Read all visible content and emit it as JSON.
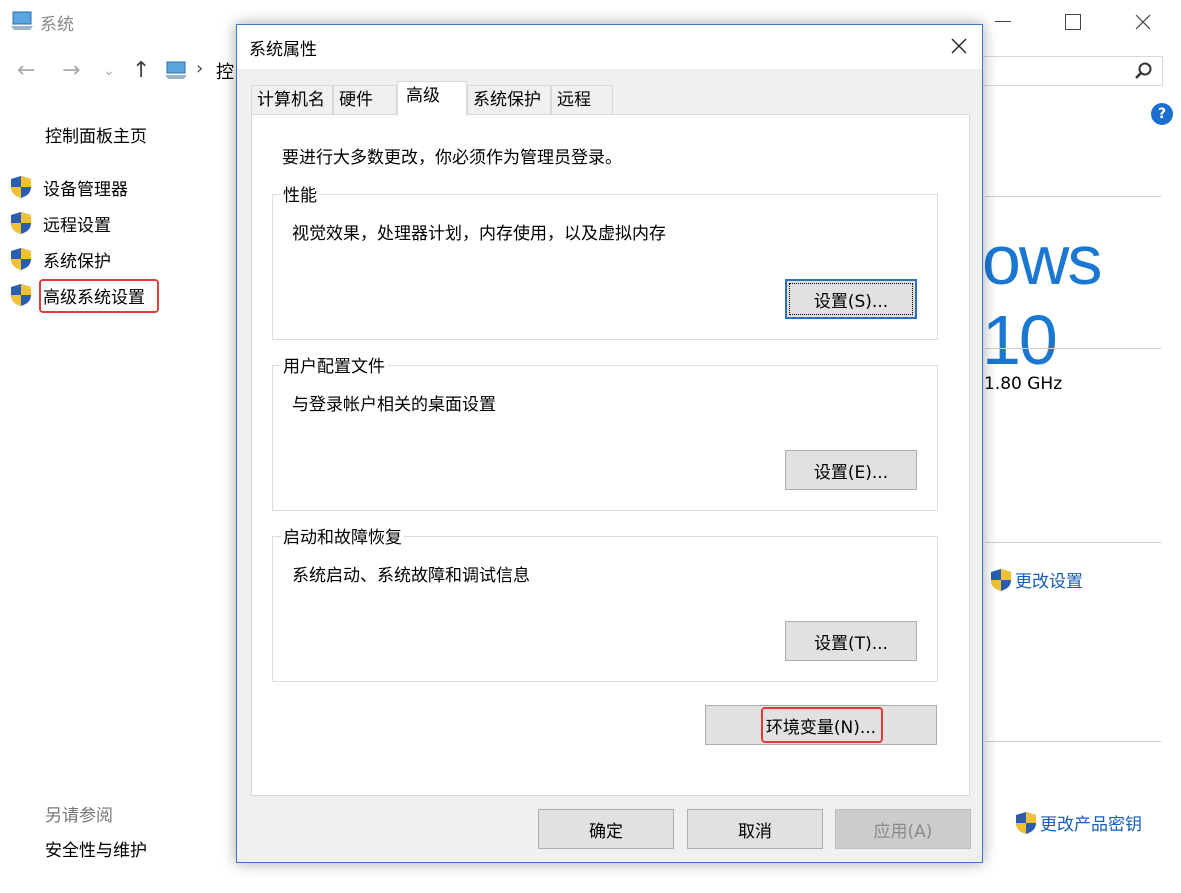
{
  "background_window": {
    "title": "系统",
    "breadcrumb_partial": "控",
    "sidebar": {
      "home": "控制面板主页",
      "items": [
        {
          "label": "设备管理器"
        },
        {
          "label": "远程设置"
        },
        {
          "label": "系统保护"
        },
        {
          "label": "高级系统设置"
        }
      ],
      "see_also": "另请参阅",
      "security": "安全性与维护"
    },
    "brand_partial": "ows 10",
    "cpu_speed_partial": "1.80 GHz",
    "change_settings": "更改设置",
    "change_product_key": "更改产品密钥"
  },
  "dialog": {
    "title": "系统属性",
    "tabs": [
      {
        "label": "计算机名"
      },
      {
        "label": "硬件"
      },
      {
        "label": "高级"
      },
      {
        "label": "系统保护"
      },
      {
        "label": "远程"
      }
    ],
    "active_tab": "高级",
    "notice": "要进行大多数更改，你必须作为管理员登录。",
    "groups": [
      {
        "title": "性能",
        "desc": "视觉效果，处理器计划，内存使用，以及虚拟内存",
        "button": "设置(S)..."
      },
      {
        "title": "用户配置文件",
        "desc": "与登录帐户相关的桌面设置",
        "button": "设置(E)..."
      },
      {
        "title": "启动和故障恢复",
        "desc": "系统启动、系统故障和调试信息",
        "button": "设置(T)..."
      }
    ],
    "env_button": "环境变量(N)...",
    "ok": "确定",
    "cancel": "取消",
    "apply": "应用(A)"
  },
  "colors": {
    "accent": "#1a78d2",
    "highlight": "#e03b3b",
    "dialog_border": "#3c78c8"
  }
}
